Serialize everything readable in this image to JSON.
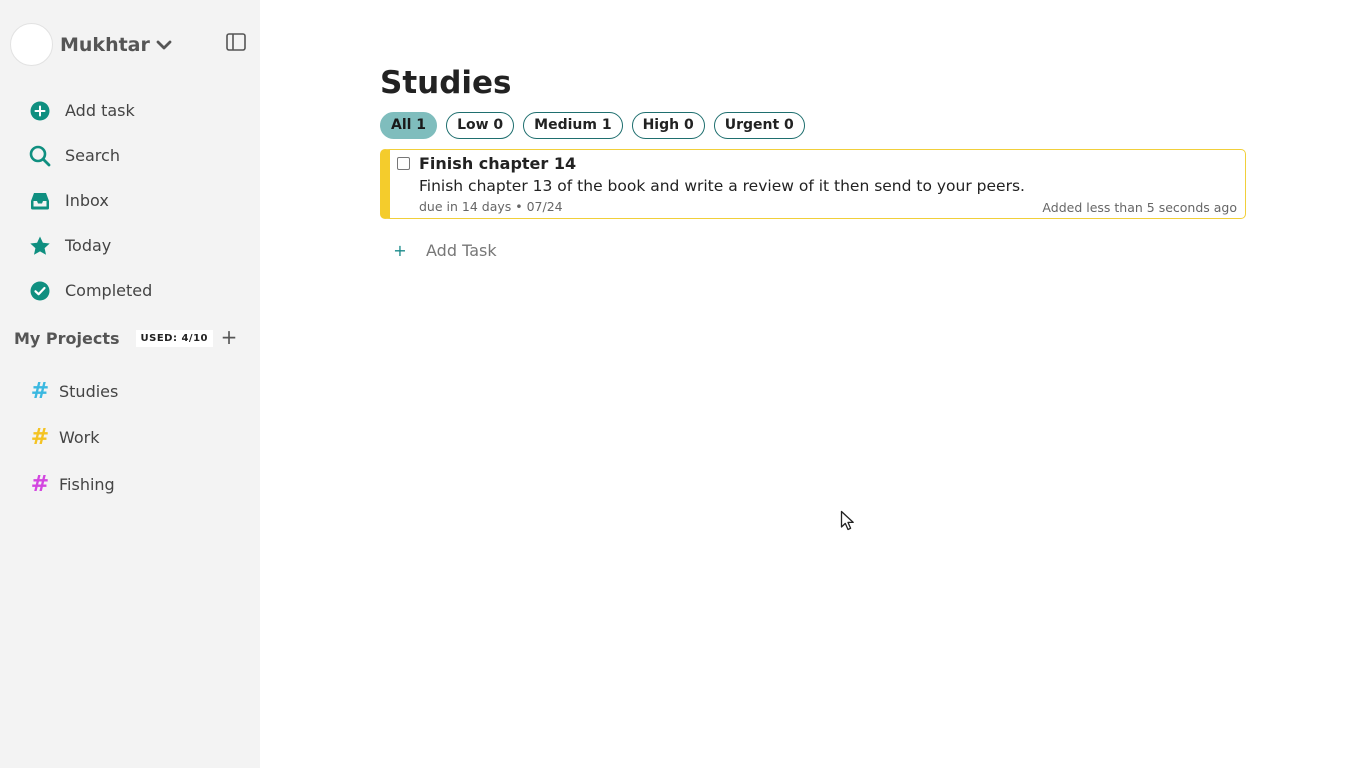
{
  "user": {
    "name": "Mukhtar"
  },
  "nav": [
    {
      "label": "Add task",
      "icon": "plus-circle-icon"
    },
    {
      "label": "Search",
      "icon": "search-icon"
    },
    {
      "label": "Inbox",
      "icon": "inbox-icon"
    },
    {
      "label": "Today",
      "icon": "star-icon"
    },
    {
      "label": "Completed",
      "icon": "check-circle-icon"
    }
  ],
  "projects": {
    "title": "My Projects",
    "used": "USED: 4/10",
    "items": [
      {
        "label": "Studies",
        "color": "#3bb8e0"
      },
      {
        "label": "Work",
        "color": "#f4c322"
      },
      {
        "label": "Fishing",
        "color": "#d346e0"
      }
    ]
  },
  "page": {
    "title": "Studies",
    "filters": [
      {
        "label": "All 1",
        "active": true
      },
      {
        "label": "Low 0",
        "active": false
      },
      {
        "label": "Medium 1",
        "active": false
      },
      {
        "label": "High 0",
        "active": false
      },
      {
        "label": "Urgent 0",
        "active": false
      }
    ],
    "task": {
      "title": "Finish chapter 14",
      "description": "Finish chapter 13 of the book and write a review of it then send to your peers.",
      "due": "due in 14 days • 07/24",
      "added": "Added less than 5 seconds ago",
      "priority_color": "#f4cc2c"
    },
    "add_task_label": "Add Task"
  },
  "colors": {
    "accent": "#0f8f80",
    "sidebar_bg": "#f3f3f3"
  }
}
